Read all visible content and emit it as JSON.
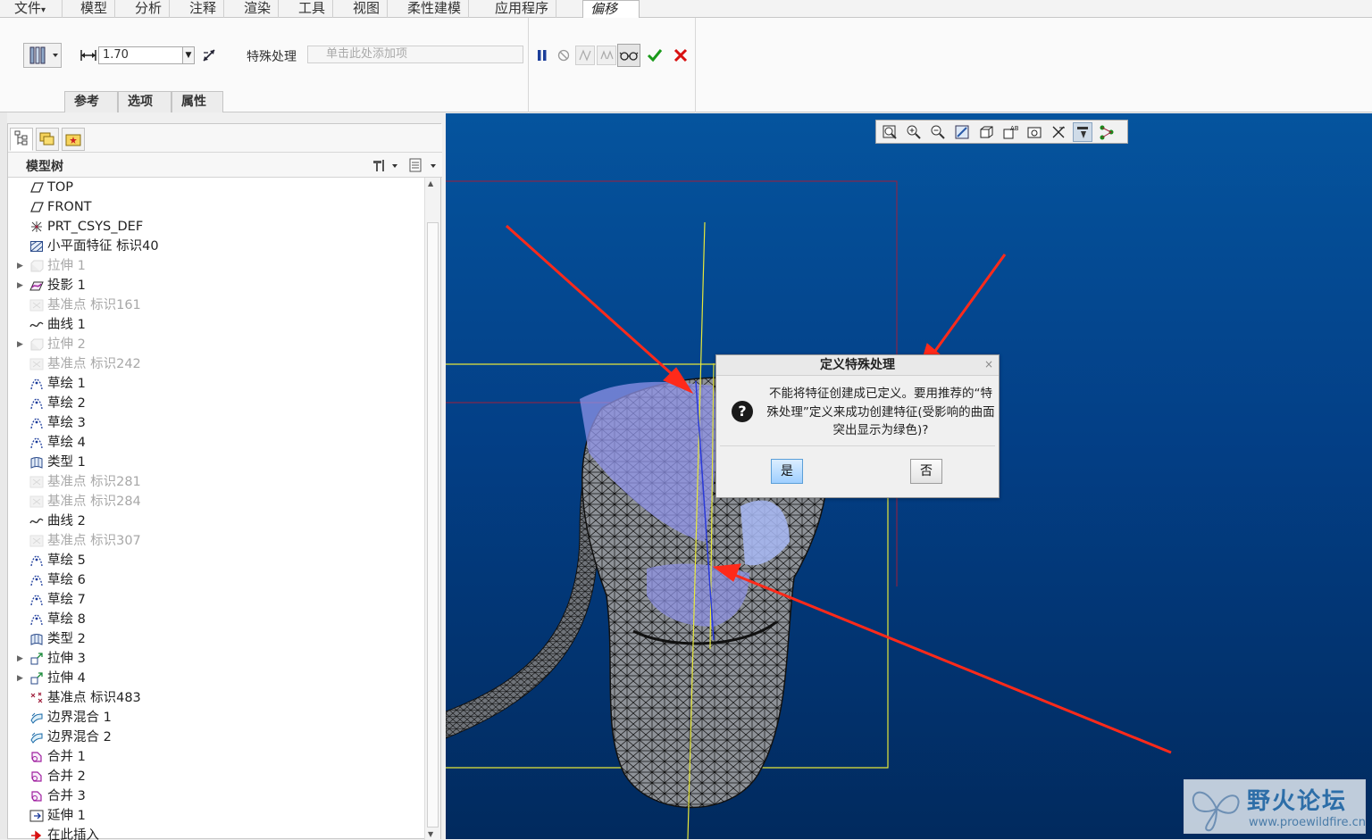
{
  "menu": {
    "items": [
      "文件",
      "模型",
      "分析",
      "注释",
      "渲染",
      "工具",
      "视图",
      "柔性建模",
      "应用程序"
    ],
    "active_tab": "偏移",
    "file_arrow": "▾"
  },
  "ribbon": {
    "thickness_value": "1.70",
    "special_label": "特殊处理",
    "special_placeholder": "单击此处添加项",
    "subtabs": [
      "参考",
      "选项",
      "属性"
    ]
  },
  "model_tree": {
    "title": "模型树",
    "items": [
      {
        "label": "TOP",
        "icon": "datum-plane-icon",
        "dim": false,
        "expand": false
      },
      {
        "label": "FRONT",
        "icon": "datum-plane-icon",
        "dim": false,
        "expand": false
      },
      {
        "label": "PRT_CSYS_DEF",
        "icon": "csys-icon",
        "dim": false,
        "expand": false
      },
      {
        "label": "小平面特征 标识40",
        "icon": "facet-icon",
        "dim": false,
        "expand": false
      },
      {
        "label": "拉伸 1",
        "icon": "extrude-icon",
        "dim": true,
        "expand": true
      },
      {
        "label": "投影 1",
        "icon": "projection-icon",
        "dim": false,
        "expand": true
      },
      {
        "label": "基准点 标识161",
        "icon": "datum-point-icon",
        "dim": true,
        "expand": false
      },
      {
        "label": "曲线 1",
        "icon": "curve-icon",
        "dim": false,
        "expand": false
      },
      {
        "label": "拉伸 2",
        "icon": "extrude-icon",
        "dim": true,
        "expand": true
      },
      {
        "label": "基准点 标识242",
        "icon": "datum-point-icon",
        "dim": true,
        "expand": false
      },
      {
        "label": "草绘 1",
        "icon": "sketch-icon",
        "dim": false,
        "expand": false
      },
      {
        "label": "草绘 2",
        "icon": "sketch-icon",
        "dim": false,
        "expand": false
      },
      {
        "label": "草绘 3",
        "icon": "sketch-icon",
        "dim": false,
        "expand": false
      },
      {
        "label": "草绘 4",
        "icon": "sketch-icon",
        "dim": false,
        "expand": false
      },
      {
        "label": "类型 1",
        "icon": "style-icon",
        "dim": false,
        "expand": false
      },
      {
        "label": "基准点 标识281",
        "icon": "datum-point-icon",
        "dim": true,
        "expand": false
      },
      {
        "label": "基准点 标识284",
        "icon": "datum-point-icon",
        "dim": true,
        "expand": false
      },
      {
        "label": "曲线 2",
        "icon": "curve-icon",
        "dim": false,
        "expand": false
      },
      {
        "label": "基准点 标识307",
        "icon": "datum-point-icon",
        "dim": true,
        "expand": false
      },
      {
        "label": "草绘 5",
        "icon": "sketch-icon",
        "dim": false,
        "expand": false
      },
      {
        "label": "草绘 6",
        "icon": "sketch-icon",
        "dim": false,
        "expand": false
      },
      {
        "label": "草绘 7",
        "icon": "sketch-icon",
        "dim": false,
        "expand": false
      },
      {
        "label": "草绘 8",
        "icon": "sketch-icon",
        "dim": false,
        "expand": false
      },
      {
        "label": "类型 2",
        "icon": "style-icon",
        "dim": false,
        "expand": false
      },
      {
        "label": "拉伸 3",
        "icon": "extrude-surface-icon",
        "dim": false,
        "expand": true
      },
      {
        "label": "拉伸 4",
        "icon": "extrude-surface-icon",
        "dim": false,
        "expand": true
      },
      {
        "label": "基准点 标识483",
        "icon": "datum-points-icon",
        "dim": false,
        "expand": false
      },
      {
        "label": "边界混合 1",
        "icon": "boundary-blend-icon",
        "dim": false,
        "expand": false
      },
      {
        "label": "边界混合 2",
        "icon": "boundary-blend-icon",
        "dim": false,
        "expand": false
      },
      {
        "label": "合并 1",
        "icon": "merge-icon",
        "dim": false,
        "expand": false
      },
      {
        "label": "合并 2",
        "icon": "merge-icon",
        "dim": false,
        "expand": false
      },
      {
        "label": "合并 3",
        "icon": "merge-icon",
        "dim": false,
        "expand": false
      },
      {
        "label": "延伸 1",
        "icon": "extend-icon",
        "dim": false,
        "expand": false
      },
      {
        "label": "在此插入",
        "icon": "insert-here-icon",
        "dim": false,
        "expand": false
      }
    ]
  },
  "dialog": {
    "title": "定义特殊处理",
    "message": "不能将特征创建成已定义。要用推荐的“特殊处理”定义来成功创建特征(受影响的曲面突出显示为绿色)?",
    "yes_label": "是",
    "no_label": "否",
    "close_glyph": "×",
    "question_glyph": "?"
  },
  "watermark": {
    "name": "野火论坛",
    "url": "www.proewildfire.cn"
  },
  "colors": {
    "viewport_top": "#05549e",
    "viewport_bottom": "#012a5e",
    "annotation_arrow": "#ff2a1a",
    "confirm_green": "#1a9a1a",
    "cancel_red": "#d81010"
  }
}
